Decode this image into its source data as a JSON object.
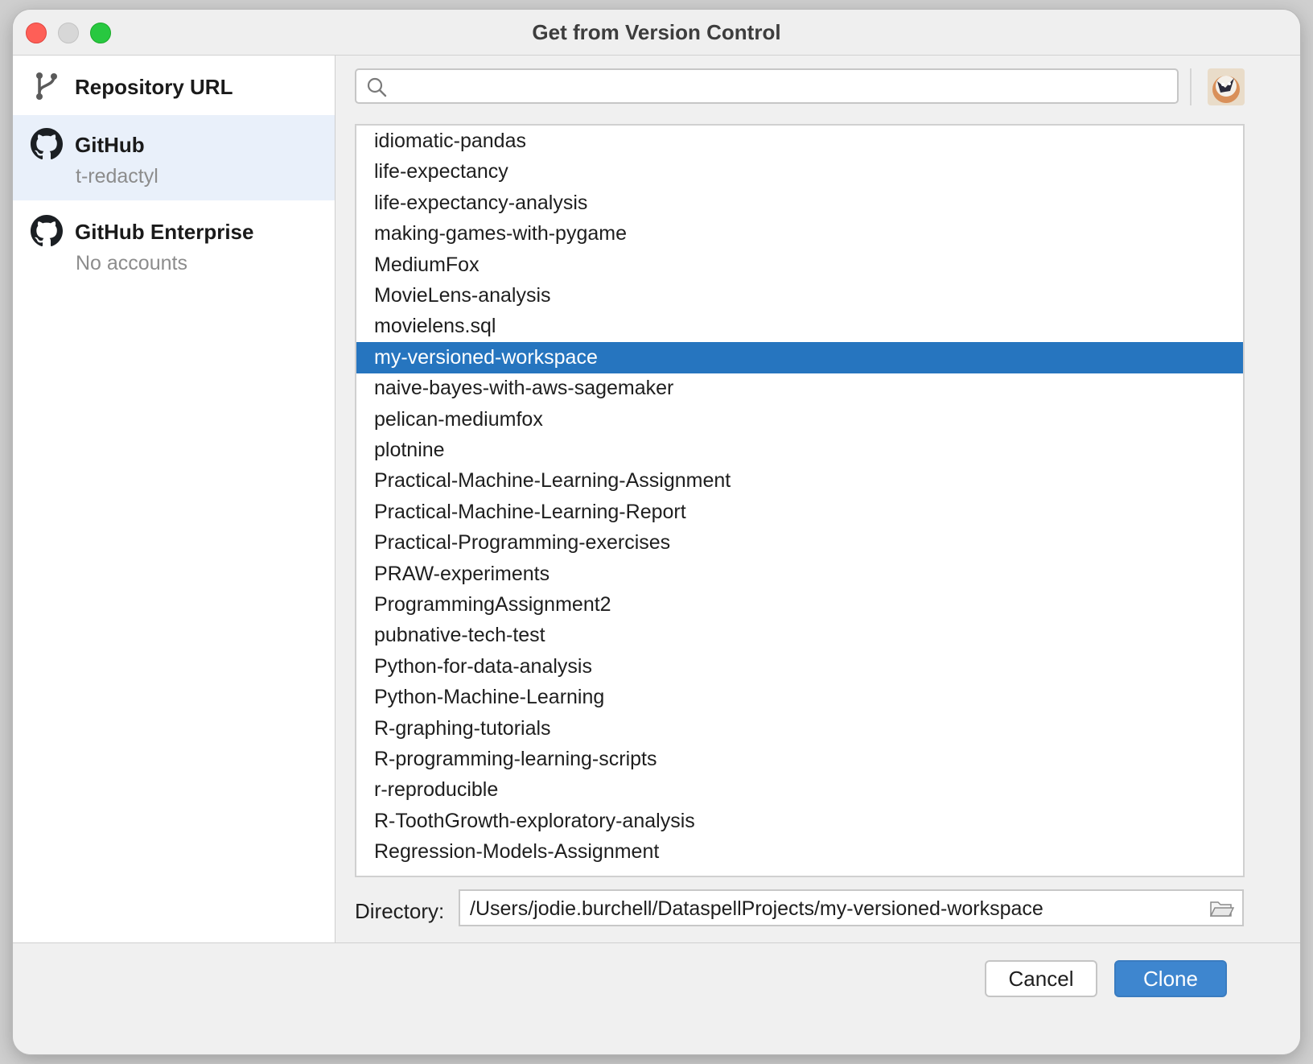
{
  "window": {
    "title": "Get from Version Control"
  },
  "sidebar": {
    "items": [
      {
        "label": "Repository URL",
        "sub": "",
        "icon": "git-branch-icon"
      },
      {
        "label": "GitHub",
        "sub": "t-redactyl",
        "icon": "github-icon",
        "selected": true
      },
      {
        "label": "GitHub Enterprise",
        "sub": "No accounts",
        "icon": "github-icon"
      }
    ]
  },
  "search": {
    "value": "",
    "placeholder": ""
  },
  "repos": {
    "items": [
      "idiomatic-pandas",
      "life-expectancy",
      "life-expectancy-analysis",
      "making-games-with-pygame",
      "MediumFox",
      "MovieLens-analysis",
      "movielens.sql",
      "my-versioned-workspace",
      "naive-bayes-with-aws-sagemaker",
      "pelican-mediumfox",
      "plotnine",
      "Practical-Machine-Learning-Assignment",
      "Practical-Machine-Learning-Report",
      "Practical-Programming-exercises",
      "PRAW-experiments",
      "ProgrammingAssignment2",
      "pubnative-tech-test",
      "Python-for-data-analysis",
      "Python-Machine-Learning",
      "R-graphing-tutorials",
      "R-programming-learning-scripts",
      "r-reproducible",
      "R-ToothGrowth-exploratory-analysis",
      "Regression-Models-Assignment"
    ],
    "selected": "my-versioned-workspace"
  },
  "directory": {
    "label": "Directory:",
    "value": "/Users/jodie.burchell/DataspellProjects/my-versioned-workspace"
  },
  "buttons": {
    "cancel": "Cancel",
    "clone": "Clone"
  },
  "colors": {
    "selection": "#2675bf",
    "primary_button": "#3e86cf",
    "sidebar_selected": "#e9f0fa"
  }
}
